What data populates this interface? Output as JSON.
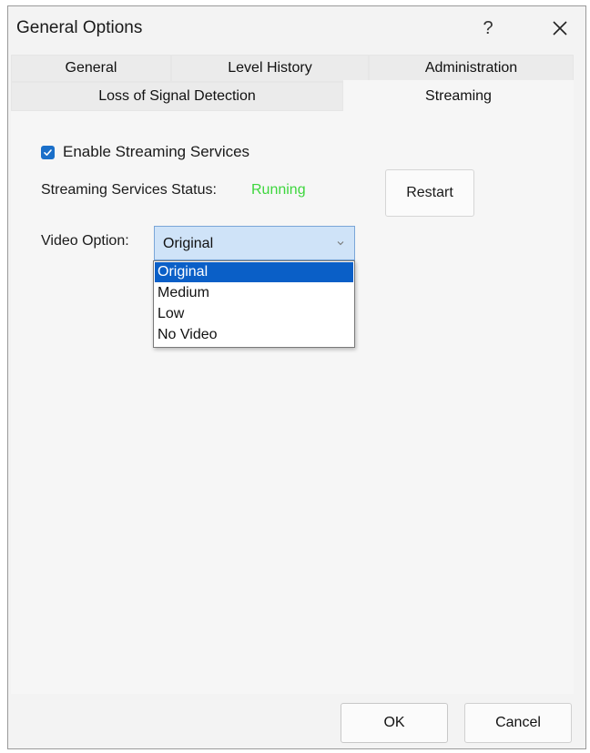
{
  "window": {
    "title": "General Options",
    "help_label": "?",
    "close_icon": "close-icon"
  },
  "tabs": {
    "row1": [
      {
        "label": "General"
      },
      {
        "label": "Level History"
      },
      {
        "label": "Administration"
      }
    ],
    "row2": [
      {
        "label": "Loss of Signal Detection"
      },
      {
        "label": "Streaming",
        "active": true
      }
    ]
  },
  "streaming": {
    "enable_label": "Enable Streaming Services",
    "enable_checked": true,
    "status_label": "Streaming Services Status:",
    "status_value": "Running",
    "status_color": "#3dd63d",
    "restart_label": "Restart",
    "video_label": "Video Option:",
    "video_selected": "Original",
    "video_options": [
      "Original",
      "Medium",
      "Low",
      "No Video"
    ]
  },
  "footer": {
    "ok_label": "OK",
    "cancel_label": "Cancel"
  },
  "colors": {
    "accent": "#0a5fc7",
    "checkbox": "#1a6fc9",
    "select_bg": "#cfe3f8"
  }
}
